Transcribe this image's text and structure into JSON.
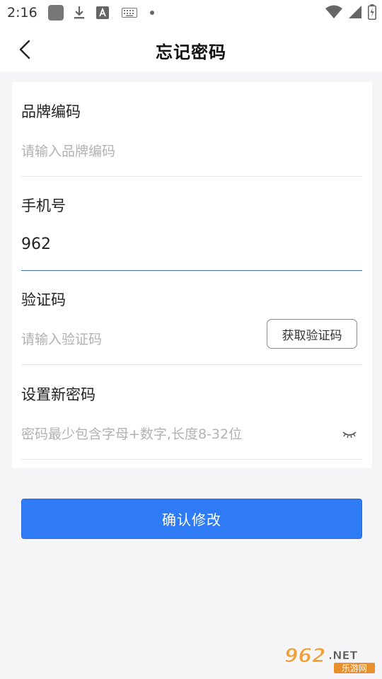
{
  "status_bar": {
    "time": "2:16",
    "icons": [
      "app-icon",
      "download-icon",
      "font-icon",
      "keyboard-icon",
      "dot-icon",
      "wifi-icon",
      "signal-icon",
      "battery-icon"
    ]
  },
  "header": {
    "title": "忘记密码",
    "back_icon": "chevron-left-icon"
  },
  "form": {
    "brand_code": {
      "label": "品牌编码",
      "placeholder": "请输入品牌编码",
      "value": ""
    },
    "phone": {
      "label": "手机号",
      "placeholder": "",
      "value": "962"
    },
    "verify_code": {
      "label": "验证码",
      "placeholder": "请输入验证码",
      "value": "",
      "button_label": "获取验证码"
    },
    "new_password": {
      "label": "设置新密码",
      "placeholder": "密码最少包含字母+数字,长度8-32位",
      "value": "",
      "toggle_icon": "eye-closed-icon"
    }
  },
  "actions": {
    "confirm_label": "确认修改"
  },
  "watermark": {
    "text_big": "962",
    "text_net": ".NET",
    "text_cn": "乐游网"
  },
  "colors": {
    "primary": "#2f7af5",
    "active_underline": "#3f6fb5",
    "placeholder": "#b2b2b2",
    "page_bg": "#f5f5f7"
  }
}
